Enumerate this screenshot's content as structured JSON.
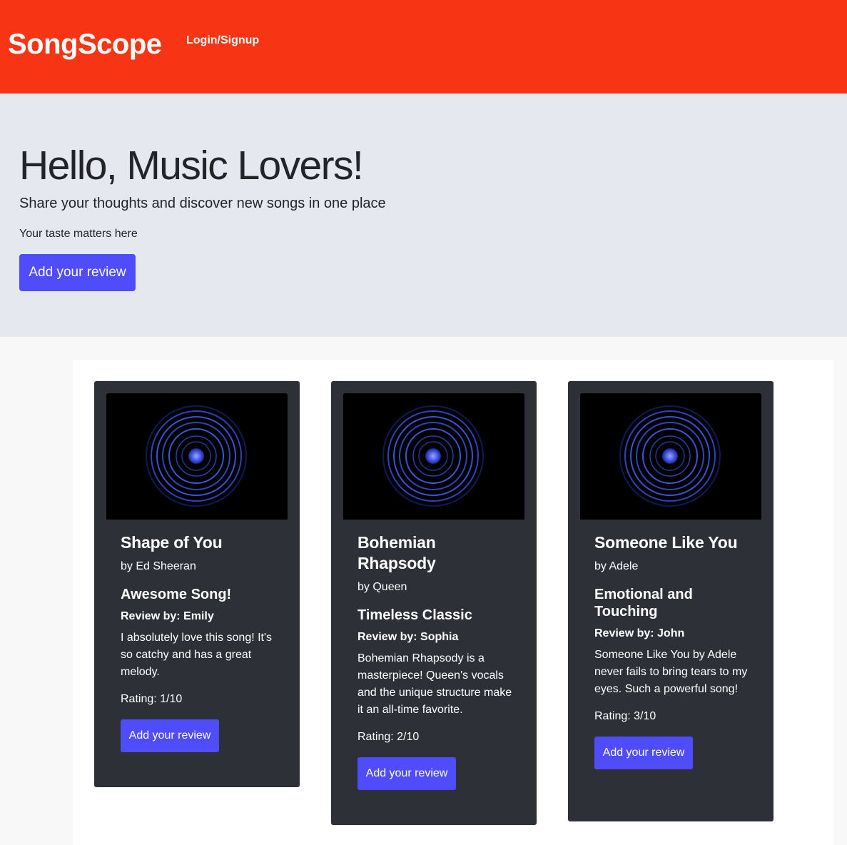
{
  "header": {
    "brand": "SongScope",
    "nav_login": "Login/Signup",
    "background_color": "#f73514"
  },
  "hero": {
    "title": "Hello, Music Lovers!",
    "subtitle": "Share your thoughts and discover new songs in one place",
    "tagline": "Your taste matters here",
    "button_label": "Add your review"
  },
  "colors": {
    "accent": "#4f4dfb",
    "card_background": "#2e3038",
    "hero_background": "#e5e8ee"
  },
  "cards": [
    {
      "image_icon": "vinyl-rings-image",
      "title": "Shape of You",
      "artist": "by Ed Sheeran",
      "review_title": "Awesome Song!",
      "reviewer": "Review by: Emily",
      "review_text": "I absolutely love this song! It's so catchy and has a great melody.",
      "rating": "Rating: 1/10",
      "button_label": "Add your review"
    },
    {
      "image_icon": "vinyl-rings-image",
      "title": "Bohemian Rhapsody",
      "artist": "by Queen",
      "review_title": "Timeless Classic",
      "reviewer": "Review by: Sophia",
      "review_text": "Bohemian Rhapsody is a masterpiece! Queen's vocals and the unique structure make it an all-time favorite.",
      "rating": "Rating: 2/10",
      "button_label": "Add your review"
    },
    {
      "image_icon": "vinyl-rings-image",
      "title": "Someone Like You",
      "artist": "by Adele",
      "review_title": "Emotional and Touching",
      "reviewer": "Review by: John",
      "review_text": "Someone Like You by Adele never fails to bring tears to my eyes. Such a powerful song!",
      "rating": "Rating: 3/10",
      "button_label": "Add your review"
    }
  ]
}
